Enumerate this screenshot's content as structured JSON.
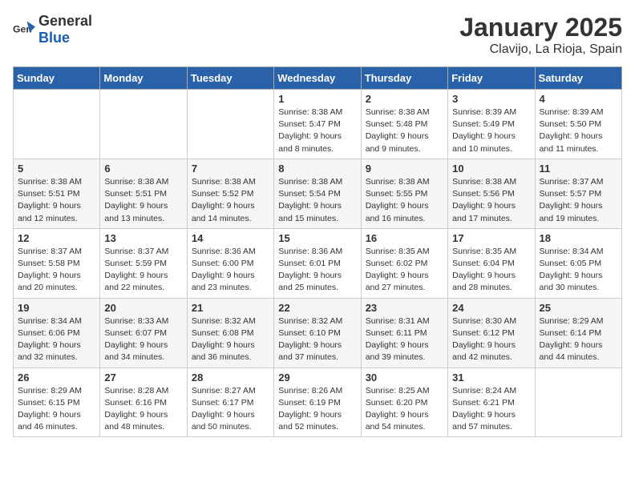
{
  "logo": {
    "general": "General",
    "blue": "Blue"
  },
  "title": "January 2025",
  "subtitle": "Clavijo, La Rioja, Spain",
  "weekdays": [
    "Sunday",
    "Monday",
    "Tuesday",
    "Wednesday",
    "Thursday",
    "Friday",
    "Saturday"
  ],
  "weeks": [
    [
      {
        "day": "",
        "info": ""
      },
      {
        "day": "",
        "info": ""
      },
      {
        "day": "",
        "info": ""
      },
      {
        "day": "1",
        "info": "Sunrise: 8:38 AM\nSunset: 5:47 PM\nDaylight: 9 hours and 8 minutes."
      },
      {
        "day": "2",
        "info": "Sunrise: 8:38 AM\nSunset: 5:48 PM\nDaylight: 9 hours and 9 minutes."
      },
      {
        "day": "3",
        "info": "Sunrise: 8:39 AM\nSunset: 5:49 PM\nDaylight: 9 hours and 10 minutes."
      },
      {
        "day": "4",
        "info": "Sunrise: 8:39 AM\nSunset: 5:50 PM\nDaylight: 9 hours and 11 minutes."
      }
    ],
    [
      {
        "day": "5",
        "info": "Sunrise: 8:38 AM\nSunset: 5:51 PM\nDaylight: 9 hours and 12 minutes."
      },
      {
        "day": "6",
        "info": "Sunrise: 8:38 AM\nSunset: 5:51 PM\nDaylight: 9 hours and 13 minutes."
      },
      {
        "day": "7",
        "info": "Sunrise: 8:38 AM\nSunset: 5:52 PM\nDaylight: 9 hours and 14 minutes."
      },
      {
        "day": "8",
        "info": "Sunrise: 8:38 AM\nSunset: 5:54 PM\nDaylight: 9 hours and 15 minutes."
      },
      {
        "day": "9",
        "info": "Sunrise: 8:38 AM\nSunset: 5:55 PM\nDaylight: 9 hours and 16 minutes."
      },
      {
        "day": "10",
        "info": "Sunrise: 8:38 AM\nSunset: 5:56 PM\nDaylight: 9 hours and 17 minutes."
      },
      {
        "day": "11",
        "info": "Sunrise: 8:37 AM\nSunset: 5:57 PM\nDaylight: 9 hours and 19 minutes."
      }
    ],
    [
      {
        "day": "12",
        "info": "Sunrise: 8:37 AM\nSunset: 5:58 PM\nDaylight: 9 hours and 20 minutes."
      },
      {
        "day": "13",
        "info": "Sunrise: 8:37 AM\nSunset: 5:59 PM\nDaylight: 9 hours and 22 minutes."
      },
      {
        "day": "14",
        "info": "Sunrise: 8:36 AM\nSunset: 6:00 PM\nDaylight: 9 hours and 23 minutes."
      },
      {
        "day": "15",
        "info": "Sunrise: 8:36 AM\nSunset: 6:01 PM\nDaylight: 9 hours and 25 minutes."
      },
      {
        "day": "16",
        "info": "Sunrise: 8:35 AM\nSunset: 6:02 PM\nDaylight: 9 hours and 27 minutes."
      },
      {
        "day": "17",
        "info": "Sunrise: 8:35 AM\nSunset: 6:04 PM\nDaylight: 9 hours and 28 minutes."
      },
      {
        "day": "18",
        "info": "Sunrise: 8:34 AM\nSunset: 6:05 PM\nDaylight: 9 hours and 30 minutes."
      }
    ],
    [
      {
        "day": "19",
        "info": "Sunrise: 8:34 AM\nSunset: 6:06 PM\nDaylight: 9 hours and 32 minutes."
      },
      {
        "day": "20",
        "info": "Sunrise: 8:33 AM\nSunset: 6:07 PM\nDaylight: 9 hours and 34 minutes."
      },
      {
        "day": "21",
        "info": "Sunrise: 8:32 AM\nSunset: 6:08 PM\nDaylight: 9 hours and 36 minutes."
      },
      {
        "day": "22",
        "info": "Sunrise: 8:32 AM\nSunset: 6:10 PM\nDaylight: 9 hours and 37 minutes."
      },
      {
        "day": "23",
        "info": "Sunrise: 8:31 AM\nSunset: 6:11 PM\nDaylight: 9 hours and 39 minutes."
      },
      {
        "day": "24",
        "info": "Sunrise: 8:30 AM\nSunset: 6:12 PM\nDaylight: 9 hours and 42 minutes."
      },
      {
        "day": "25",
        "info": "Sunrise: 8:29 AM\nSunset: 6:14 PM\nDaylight: 9 hours and 44 minutes."
      }
    ],
    [
      {
        "day": "26",
        "info": "Sunrise: 8:29 AM\nSunset: 6:15 PM\nDaylight: 9 hours and 46 minutes."
      },
      {
        "day": "27",
        "info": "Sunrise: 8:28 AM\nSunset: 6:16 PM\nDaylight: 9 hours and 48 minutes."
      },
      {
        "day": "28",
        "info": "Sunrise: 8:27 AM\nSunset: 6:17 PM\nDaylight: 9 hours and 50 minutes."
      },
      {
        "day": "29",
        "info": "Sunrise: 8:26 AM\nSunset: 6:19 PM\nDaylight: 9 hours and 52 minutes."
      },
      {
        "day": "30",
        "info": "Sunrise: 8:25 AM\nSunset: 6:20 PM\nDaylight: 9 hours and 54 minutes."
      },
      {
        "day": "31",
        "info": "Sunrise: 8:24 AM\nSunset: 6:21 PM\nDaylight: 9 hours and 57 minutes."
      },
      {
        "day": "",
        "info": ""
      }
    ]
  ]
}
